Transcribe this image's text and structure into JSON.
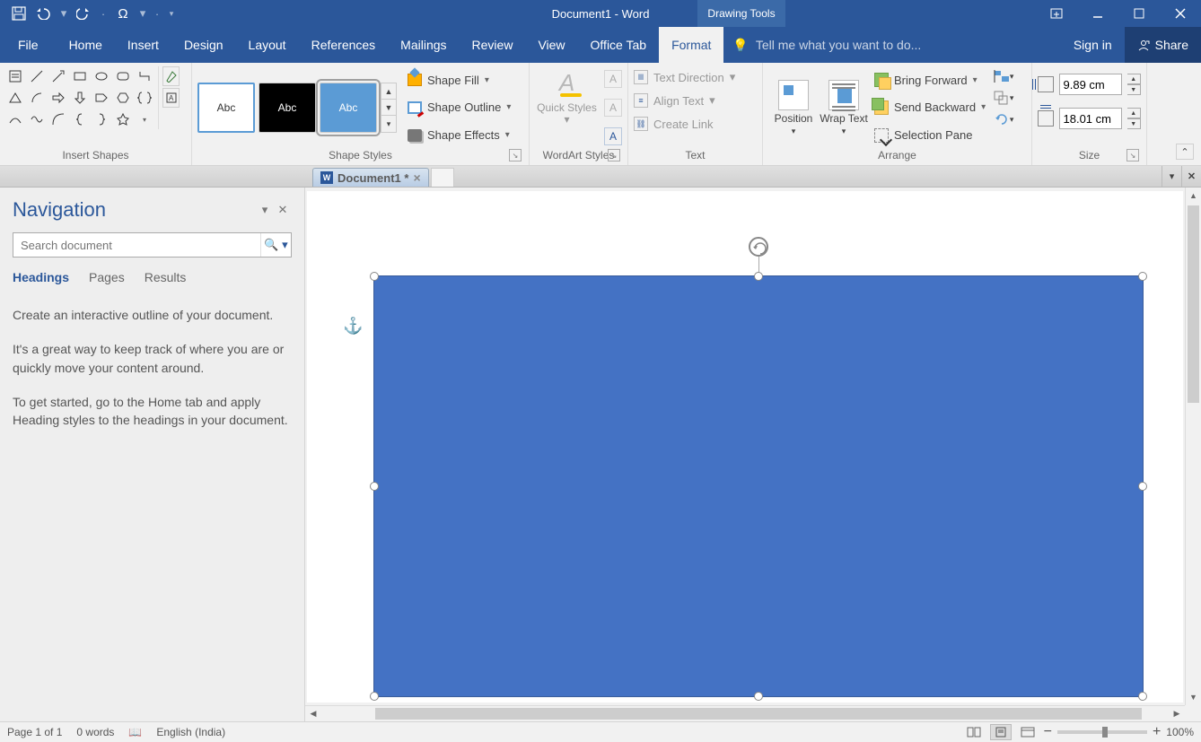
{
  "titlebar": {
    "title": "Document1 - Word",
    "tools_tab": "Drawing Tools"
  },
  "tabs": {
    "file": "File",
    "home": "Home",
    "insert": "Insert",
    "design": "Design",
    "layout": "Layout",
    "references": "References",
    "mailings": "Mailings",
    "review": "Review",
    "view": "View",
    "office_tab": "Office Tab",
    "format": "Format",
    "tellme_placeholder": "Tell me what you want to do...",
    "signin": "Sign in",
    "share": "Share"
  },
  "groups": {
    "insert_shapes": "Insert Shapes",
    "shape_styles": "Shape Styles",
    "wordart_styles": "WordArt Styles",
    "text": "Text",
    "arrange": "Arrange",
    "size": "Size"
  },
  "shape_styles": {
    "thumb_label": "Abc",
    "fill": "Shape Fill",
    "outline": "Shape Outline",
    "effects": "Shape Effects"
  },
  "wordart": {
    "quick_styles": "Quick Styles"
  },
  "text": {
    "direction": "Text Direction",
    "align": "Align Text",
    "link": "Create Link"
  },
  "arrange": {
    "position": "Position",
    "wrap": "Wrap Text",
    "bring_forward": "Bring Forward",
    "send_backward": "Send Backward",
    "selection_pane": "Selection Pane"
  },
  "size": {
    "height": "9.89 cm",
    "width": "18.01 cm"
  },
  "doc_tab": {
    "name": "Document1 *"
  },
  "nav": {
    "title": "Navigation",
    "search_placeholder": "Search document",
    "tab_headings": "Headings",
    "tab_pages": "Pages",
    "tab_results": "Results",
    "p1": "Create an interactive outline of your document.",
    "p2": "It's a great way to keep track of where you are or quickly move your content around.",
    "p3": "To get started, go to the Home tab and apply Heading styles to the headings in your document."
  },
  "status": {
    "page": "Page 1 of 1",
    "words": "0 words",
    "lang": "English (India)",
    "zoom": "100%"
  }
}
